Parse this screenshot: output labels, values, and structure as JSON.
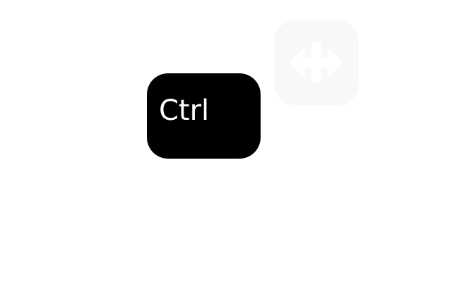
{
  "keys": {
    "ctrl": {
      "label": "Ctrl",
      "background": "#000000",
      "text_color": "#ffffff"
    },
    "move": {
      "icon": "four-way-arrows-icon",
      "background": "#f8f8f8",
      "icon_color": "#ffffff"
    }
  }
}
